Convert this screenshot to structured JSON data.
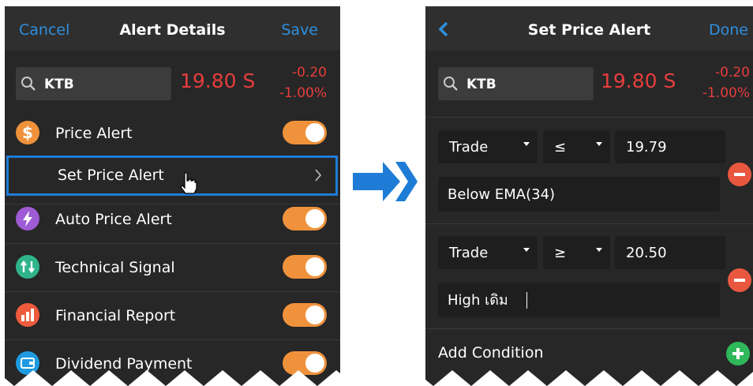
{
  "left_screen": {
    "nav": {
      "cancel": "Cancel",
      "title": "Alert Details",
      "save": "Save"
    },
    "search": {
      "symbol": "KTB",
      "price": "19.80 S",
      "change": "-0.20",
      "change_pct": "-1.00%"
    },
    "rows": [
      {
        "label": "Price Alert",
        "icon": "dollar-icon",
        "icon_color": "#f0923b",
        "on": true
      },
      {
        "label": "Set Price Alert",
        "icon": "chevron-right-icon",
        "highlighted": true
      },
      {
        "label": "Auto Price Alert",
        "icon": "lightning-icon",
        "icon_color": "#9f5bd6",
        "on": true
      },
      {
        "label": "Technical Signal",
        "icon": "technical-signal-icon",
        "icon_color": "#2fb48a",
        "on": true
      },
      {
        "label": "Financial Report",
        "icon": "bar-chart-icon",
        "icon_color": "#ef5b3c",
        "on": true
      },
      {
        "label": "Dividend Payment",
        "icon": "wallet-icon",
        "icon_color": "#1e9be0",
        "on": true
      }
    ]
  },
  "arrow": {
    "icon": "double-chevron-right-icon",
    "color": "#1e7cd6"
  },
  "right_screen": {
    "nav": {
      "back": "back-chevron-icon",
      "title": "Set Price Alert",
      "done": "Done"
    },
    "search": {
      "symbol": "KTB",
      "price": "19.80 S",
      "change": "-0.20",
      "change_pct": "-1.00%"
    },
    "conditions": [
      {
        "type": "Trade",
        "operator": "≤",
        "value": "19.79",
        "note": "Below EMA(34)"
      },
      {
        "type": "Trade",
        "operator": "≥",
        "value": "20.50",
        "note": "High เดิม"
      }
    ],
    "add_condition": "Add Condition"
  },
  "colors": {
    "accent_blue": "#2f8fdd",
    "price_red": "#e63d3d",
    "toggle_orange": "#f0923b",
    "add_green": "#2fb85a",
    "remove_red": "#e9573f"
  }
}
